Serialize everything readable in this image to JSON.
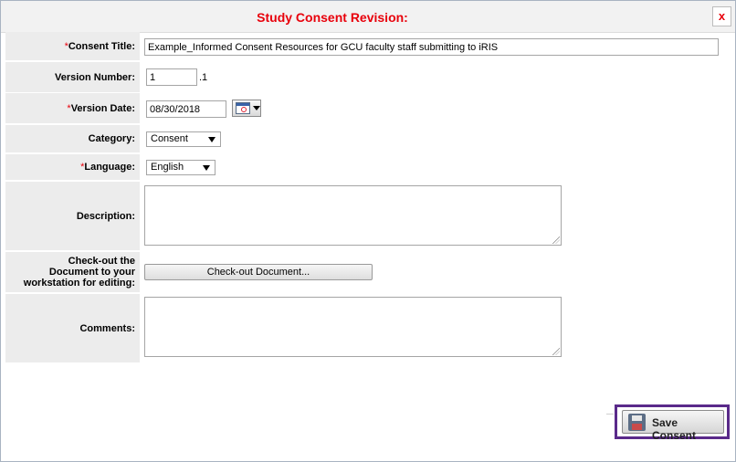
{
  "dialog": {
    "title": "Study Consent Revision:",
    "close_label": "x"
  },
  "form": {
    "consent_title": {
      "label": "Consent Title:",
      "required_mark": "*",
      "value": "Example_Informed Consent Resources for GCU faculty staff submitting to iRIS"
    },
    "version_number": {
      "label": "Version Number:",
      "value": "1",
      "suffix": ".1"
    },
    "version_date": {
      "label": "Version Date:",
      "required_mark": "*",
      "value": "08/30/2018"
    },
    "category": {
      "label": "Category:",
      "selected": "Consent"
    },
    "language": {
      "label": "Language:",
      "required_mark": "* ",
      "selected": "English"
    },
    "description": {
      "label": "Description:",
      "value": ""
    },
    "checkout": {
      "label_line1": "Check-out the",
      "label_line2": "Document to your",
      "label_line3": "workstation for editing:",
      "button_label": "Check-out Document..."
    },
    "comments": {
      "label": "Comments:",
      "value": ""
    }
  },
  "footer": {
    "save_label": "Save Consent"
  }
}
